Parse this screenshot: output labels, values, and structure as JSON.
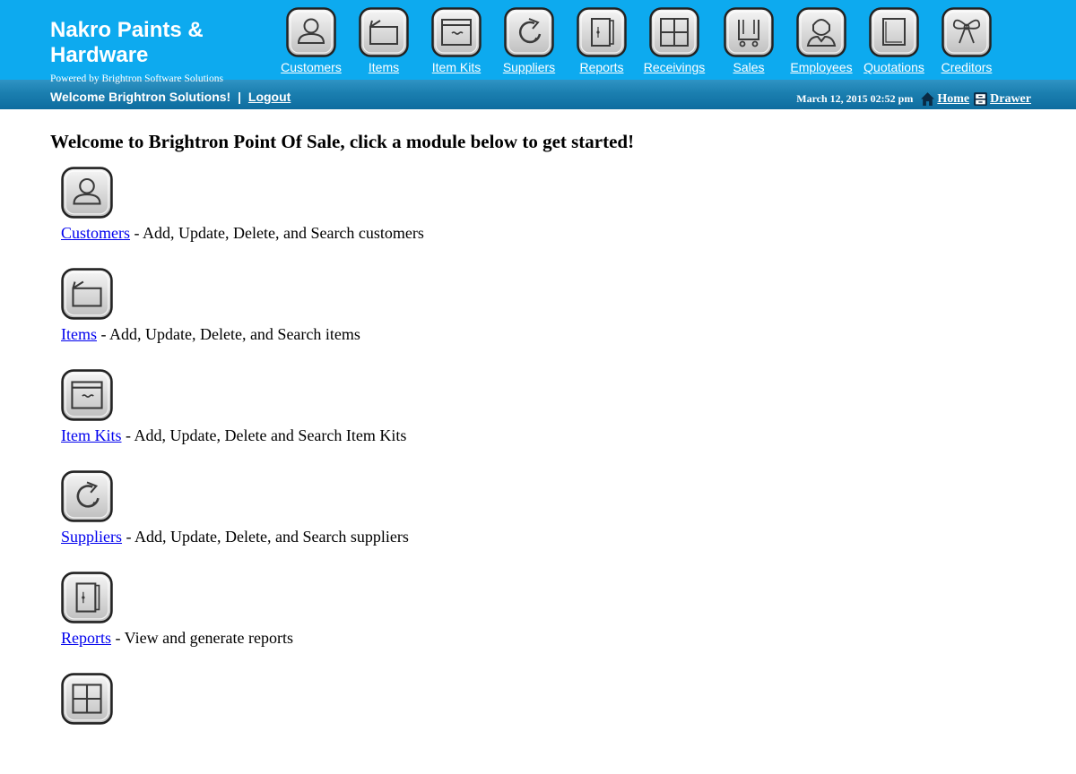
{
  "header": {
    "company_name": "Nakro Paints & Hardware",
    "powered_by": "Powered by Brightron Software Solutions",
    "welcome": "Welcome Brightron Solutions!",
    "separator": "|",
    "logout": "Logout",
    "datetime": "March 12, 2015 02:52 pm",
    "home": "Home",
    "drawer": "Drawer",
    "color": "#0daaef"
  },
  "nav": [
    {
      "label": "Customers",
      "icon": "customer-icon"
    },
    {
      "label": "Items",
      "icon": "items-icon"
    },
    {
      "label": "Item Kits",
      "icon": "item-kits-icon"
    },
    {
      "label": "Suppliers",
      "icon": "suppliers-icon"
    },
    {
      "label": "Reports",
      "icon": "reports-icon"
    },
    {
      "label": "Receivings",
      "icon": "receivings-icon"
    },
    {
      "label": "Sales",
      "icon": "sales-icon"
    },
    {
      "label": "Employees",
      "icon": "employees-icon"
    },
    {
      "label": "Quotations",
      "icon": "quotations-icon"
    },
    {
      "label": "Creditors",
      "icon": "creditors-icon"
    }
  ],
  "main": {
    "title": "Welcome to Brightron Point Of Sale, click a module below to get started!",
    "modules": [
      {
        "link": "Customers",
        "desc": " - Add, Update, Delete, and Search customers",
        "icon": "customer-icon"
      },
      {
        "link": "Items",
        "desc": " - Add, Update, Delete, and Search items",
        "icon": "items-icon"
      },
      {
        "link": "Item Kits",
        "desc": " - Add, Update, Delete and Search Item Kits",
        "icon": "item-kits-icon"
      },
      {
        "link": "Suppliers",
        "desc": " - Add, Update, Delete, and Search suppliers",
        "icon": "suppliers-icon"
      },
      {
        "link": "Reports",
        "desc": " - View and generate reports",
        "icon": "reports-icon"
      },
      {
        "link": "",
        "desc": "",
        "icon": "receivings-icon"
      }
    ]
  }
}
